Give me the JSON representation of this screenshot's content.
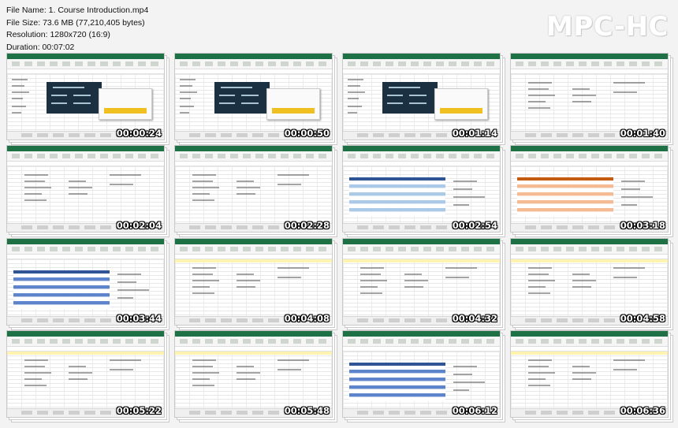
{
  "file_info": {
    "file_name": "File Name: 1. Course Introduction.mp4",
    "file_size": "File Size: 73.6 MB (77,210,405 bytes)",
    "resolution": "Resolution: 1280x720 (16:9)",
    "duration": "Duration: 00:07:02"
  },
  "logo": "MPC-HC",
  "thumbnails": [
    {
      "timestamp": "00:00:24",
      "kind": "slide"
    },
    {
      "timestamp": "00:00:50",
      "kind": "slide"
    },
    {
      "timestamp": "00:01:14",
      "kind": "slide"
    },
    {
      "timestamp": "00:01:40",
      "kind": "sheet"
    },
    {
      "timestamp": "00:02:04",
      "kind": "sheet"
    },
    {
      "timestamp": "00:02:28",
      "kind": "sheet"
    },
    {
      "timestamp": "00:02:54",
      "kind": "table",
      "accent": "#9dc3e6"
    },
    {
      "timestamp": "00:03:18",
      "kind": "table",
      "accent": "#f4b183"
    },
    {
      "timestamp": "00:03:44",
      "kind": "table",
      "accent": "#4472c4"
    },
    {
      "timestamp": "00:04:08",
      "kind": "sheet"
    },
    {
      "timestamp": "00:04:32",
      "kind": "sheet"
    },
    {
      "timestamp": "00:04:58",
      "kind": "sheet"
    },
    {
      "timestamp": "00:05:22",
      "kind": "sheet"
    },
    {
      "timestamp": "00:05:48",
      "kind": "sheet"
    },
    {
      "timestamp": "00:06:12",
      "kind": "table",
      "accent": "#4472c4"
    },
    {
      "timestamp": "00:06:36",
      "kind": "sheet"
    }
  ],
  "colors": {
    "excel_green": "#1e7145",
    "slide_navy": "#1b3040",
    "highlight_yellow": "#f0c020"
  }
}
